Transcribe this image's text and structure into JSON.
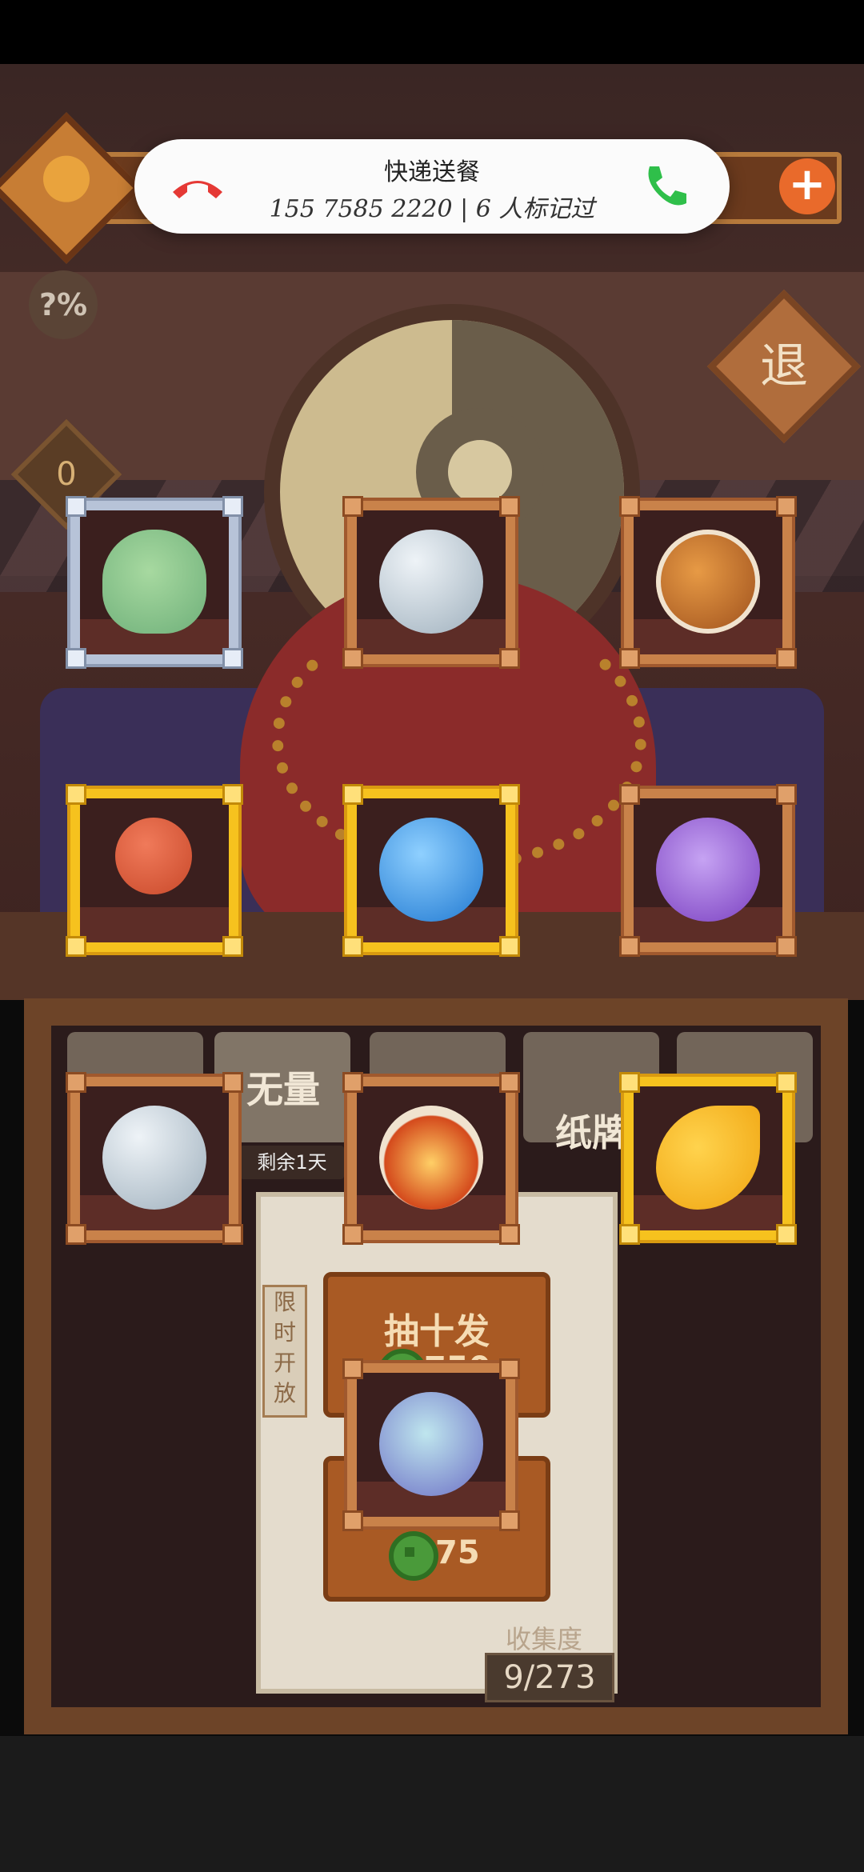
{
  "incoming_call": {
    "caller_name": "快递送餐",
    "caller_detail": "155 7585 2220 | 6 人标记过"
  },
  "hud": {
    "counter_value": "0",
    "exit_label": "退",
    "discount_icon_text": "?%"
  },
  "tabs": [
    {
      "label": ""
    },
    {
      "label": "无量",
      "remaining": "剩余1天"
    },
    {
      "label": ""
    },
    {
      "label": "纸牌"
    },
    {
      "label": ""
    }
  ],
  "gacha": {
    "limited_label": [
      "限",
      "时",
      "开",
      "放"
    ],
    "draw_ten_label": "抽十发",
    "draw_ten_cost": "750",
    "draw_one_cost": "75"
  },
  "collection": {
    "label": "收集度",
    "value": "9/273"
  },
  "items": [
    {
      "rarity": "silver",
      "icon": "green-fish-spirit-icon"
    },
    {
      "rarity": "bronze",
      "icon": "cleaver-orb-icon"
    },
    {
      "rarity": "bronze",
      "icon": "bronze-pot-orb-icon"
    },
    {
      "rarity": "gold",
      "icon": "red-stamp-seal-icon"
    },
    {
      "rarity": "gold",
      "icon": "water-drop-orb-icon"
    },
    {
      "rarity": "bronze",
      "icon": "purple-eye-amulet-orb-icon"
    },
    {
      "rarity": "bronze",
      "icon": "cleaver-orb-icon"
    },
    {
      "rarity": "bronze",
      "icon": "fire-orb-icon"
    },
    {
      "rarity": "gold",
      "icon": "golden-leaf-icon"
    },
    {
      "rarity": "bronze",
      "icon": "crystal-cube-orb-icon"
    }
  ],
  "colors": {
    "gold_frame": "#f6c21e",
    "bronze_frame": "#c9824a",
    "silver_frame": "#b7c3d8",
    "accept_call": "#2fbf4a",
    "decline_call": "#e53935"
  }
}
